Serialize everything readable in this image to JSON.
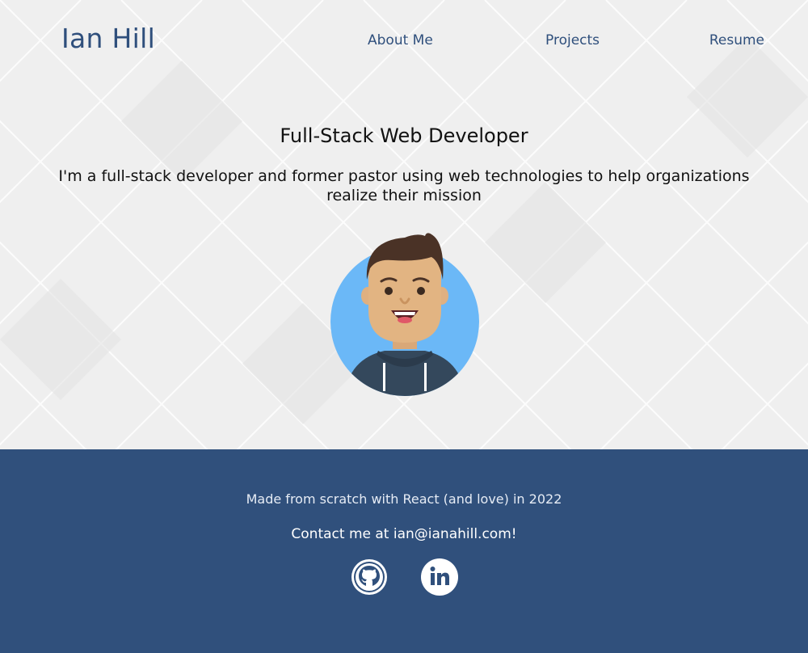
{
  "header": {
    "site_name": "Ian Hill",
    "nav": [
      {
        "label": "About Me"
      },
      {
        "label": "Projects"
      },
      {
        "label": "Resume"
      }
    ]
  },
  "hero": {
    "title": "Full-Stack Web Developer",
    "subtitle": "I'm a full-stack developer and former pastor using web technologies to help organizations realize their mission",
    "avatar_icon": "avatar-illustration"
  },
  "footer": {
    "made_with": "Made from scratch with React (and love) in 2022",
    "contact": "Contact me at ian@ianahill.com!",
    "social": [
      {
        "icon": "github-icon"
      },
      {
        "icon": "linkedin-icon"
      }
    ]
  },
  "colors": {
    "brand": "#2f4f7c",
    "footer_bg": "#30507c",
    "hero_bg": "#efefef",
    "avatar_bg": "#6bb8f7"
  }
}
